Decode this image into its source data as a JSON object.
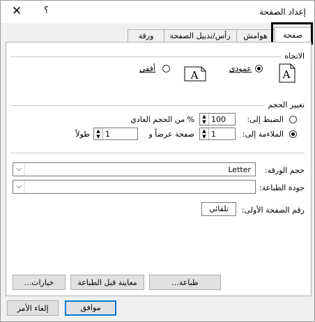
{
  "window": {
    "title": "إعداد الصفحة",
    "help": "؟",
    "close": "✕"
  },
  "tabs": [
    {
      "label": "صفحة",
      "active": true
    },
    {
      "label": "هوامش",
      "active": false
    },
    {
      "label": "رأس/تذييل الصفحة",
      "active": false
    },
    {
      "label": "ورقة",
      "active": false
    }
  ],
  "orientation": {
    "group_label": "الاتجاه",
    "portrait_label": "عمودي",
    "landscape_label": "أفقي",
    "selected": "portrait",
    "icon_letter": "A"
  },
  "scaling": {
    "group_label": "تغيير الحجم",
    "adjust_label": "الضبط إلى:",
    "adjust_value": "100",
    "adjust_suffix": "% من الحجم العادي",
    "fit_label": "الملاءمة إلى:",
    "fit_wide_value": "1",
    "fit_wide_suffix": "صفحة عرضاً و",
    "fit_tall_value": "1",
    "fit_tall_suffix": "طولاً",
    "selected": "fit"
  },
  "paper_size": {
    "label": "حجم الورقة:",
    "value": "Letter"
  },
  "print_quality": {
    "label": "جودة الطباعة:",
    "value": ""
  },
  "first_page": {
    "label": "رقم الصفحة الأولى:",
    "value": "تلقائي"
  },
  "page_buttons": {
    "print": "طباعة...",
    "preview": "معاينة قبل الطباعة",
    "options": "خيارات..."
  },
  "dialog_buttons": {
    "ok": "موافق",
    "cancel": "إلغاء الأمر"
  }
}
